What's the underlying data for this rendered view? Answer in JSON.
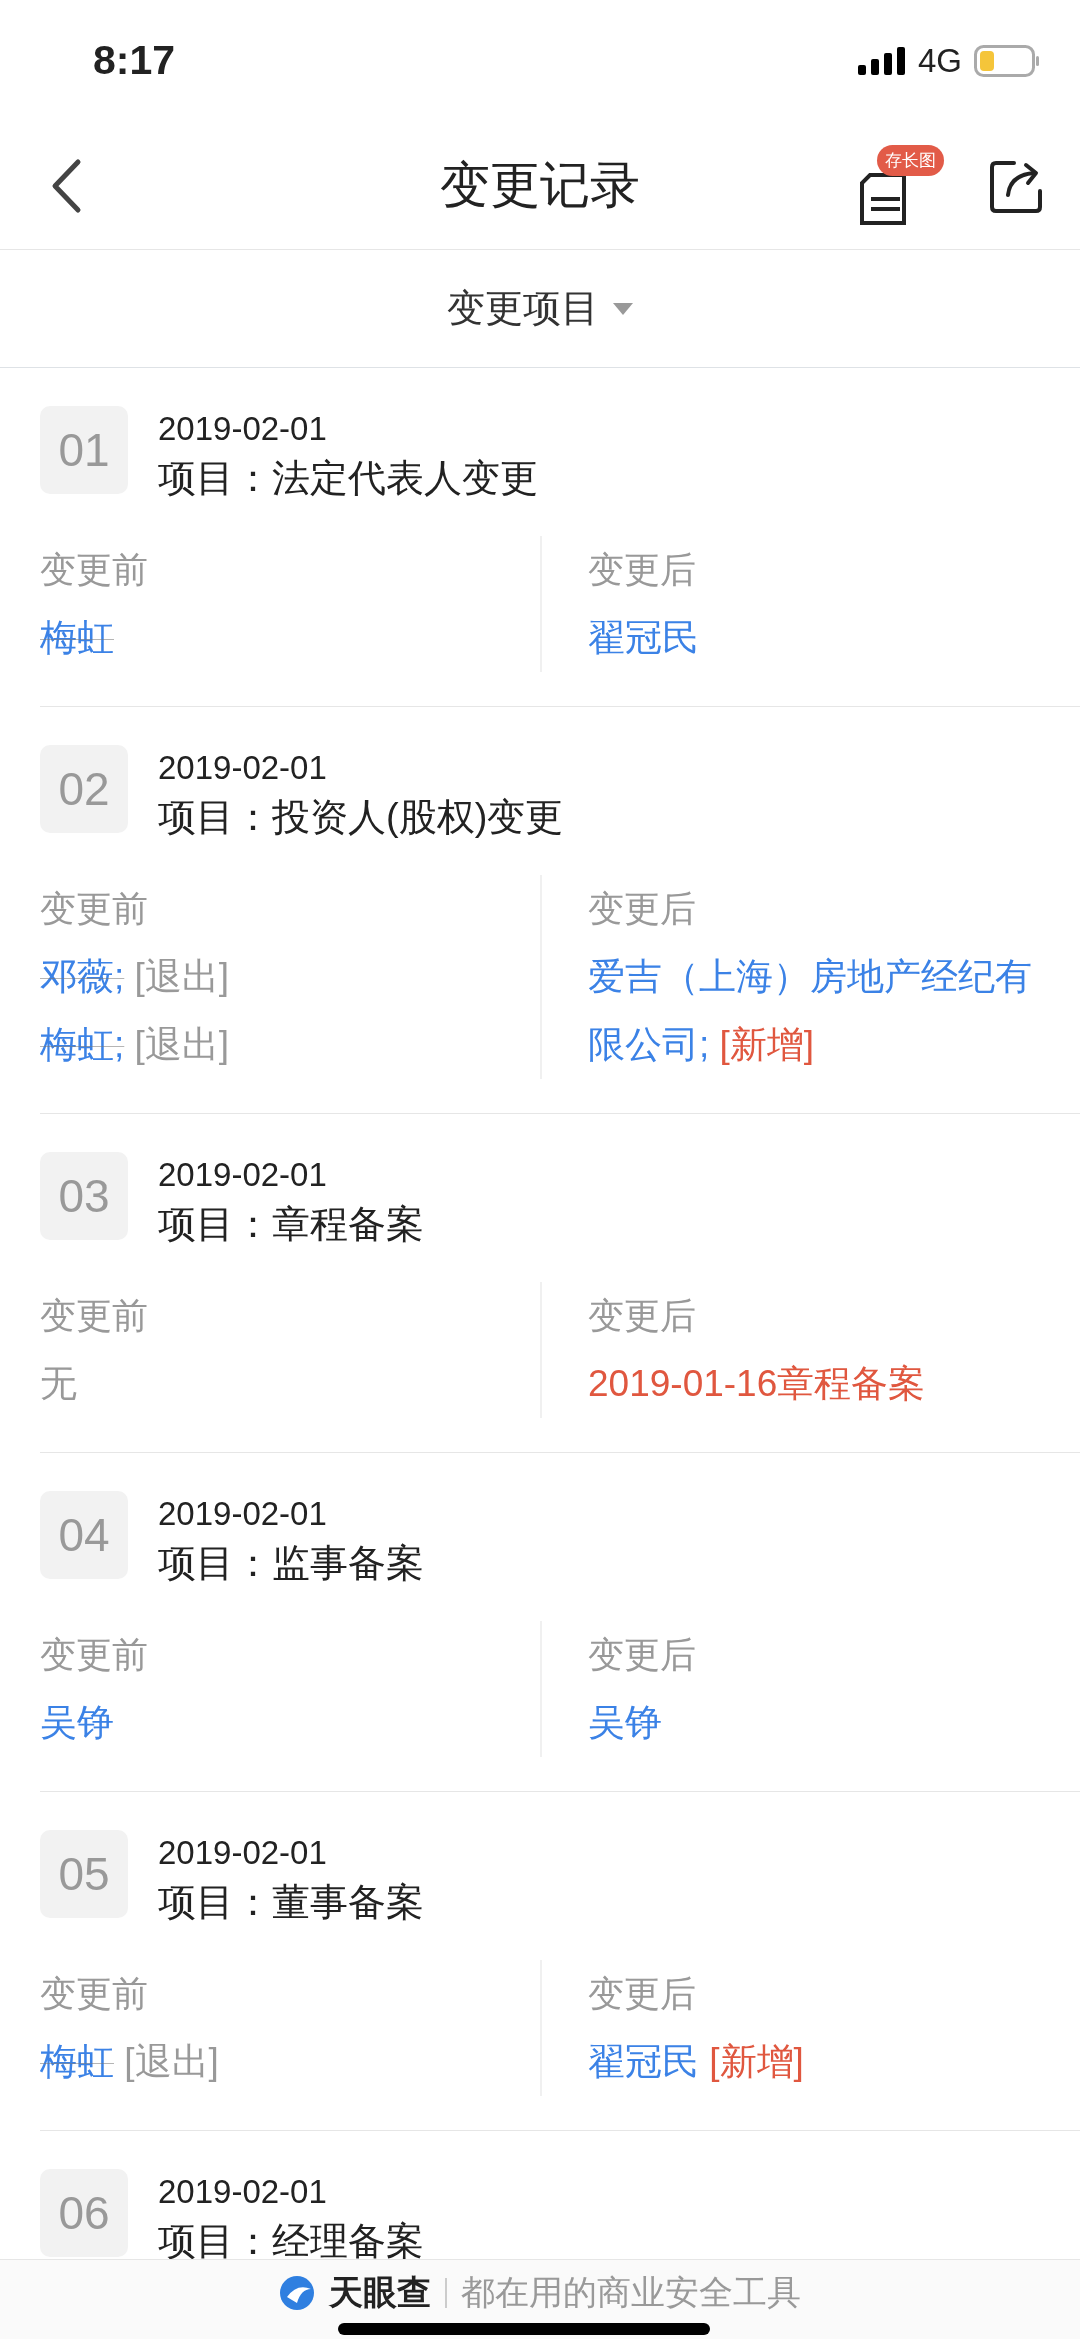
{
  "status_bar": {
    "time": "8:17",
    "network": "4G"
  },
  "nav": {
    "title": "变更记录",
    "badge": "存长图"
  },
  "filter": {
    "label": "变更项目"
  },
  "records": [
    {
      "number": "01",
      "date": "2019-02-01",
      "item_label": "项目：",
      "item": "法定代表人变更",
      "before_label": "变更前",
      "after_label": "变更后",
      "before": [
        [
          {
            "kind": "name",
            "text": "梅虹",
            "struck": true
          }
        ]
      ],
      "after": [
        [
          {
            "kind": "name",
            "text": "翟冠民",
            "struck": false
          }
        ]
      ]
    },
    {
      "number": "02",
      "date": "2019-02-01",
      "item_label": "项目：",
      "item": "投资人(股权)变更",
      "before_label": "变更前",
      "after_label": "变更后",
      "before": [
        [
          {
            "kind": "name",
            "text": "邓薇;",
            "struck": true
          },
          {
            "kind": "note",
            "text": "[退出]",
            "struck": false
          }
        ],
        [
          {
            "kind": "name",
            "text": "梅虹;",
            "struck": true
          },
          {
            "kind": "note",
            "text": "[退出]",
            "struck": false
          }
        ]
      ],
      "after": [
        [
          {
            "kind": "name",
            "text": "爱吉（上海）房地产经纪有限公司;",
            "struck": false
          },
          {
            "kind": "added",
            "text": "[新增]",
            "struck": false
          }
        ]
      ]
    },
    {
      "number": "03",
      "date": "2019-02-01",
      "item_label": "项目：",
      "item": "章程备案",
      "before_label": "变更前",
      "after_label": "变更后",
      "before": [
        [
          {
            "kind": "plain",
            "text": "无",
            "struck": false
          }
        ]
      ],
      "after": [
        [
          {
            "kind": "added",
            "text": "2019-01-16章程备案",
            "struck": false
          }
        ]
      ]
    },
    {
      "number": "04",
      "date": "2019-02-01",
      "item_label": "项目：",
      "item": "监事备案",
      "before_label": "变更前",
      "after_label": "变更后",
      "before": [
        [
          {
            "kind": "name",
            "text": "吴铮",
            "struck": false
          }
        ]
      ],
      "after": [
        [
          {
            "kind": "name",
            "text": "吴铮",
            "struck": false
          }
        ]
      ]
    },
    {
      "number": "05",
      "date": "2019-02-01",
      "item_label": "项目：",
      "item": "董事备案",
      "before_label": "变更前",
      "after_label": "变更后",
      "before": [
        [
          {
            "kind": "name",
            "text": "梅虹",
            "struck": true
          },
          {
            "kind": "note",
            "text": "[退出]",
            "struck": false
          }
        ]
      ],
      "after": [
        [
          {
            "kind": "name",
            "text": "翟冠民",
            "struck": false
          },
          {
            "kind": "added",
            "text": "[新增]",
            "struck": false
          }
        ]
      ]
    },
    {
      "number": "06",
      "date": "2019-02-01",
      "item_label": "项目：",
      "item": "经理备案"
    }
  ],
  "footer": {
    "brand": "天眼查",
    "slogan": "都在用的商业安全工具"
  }
}
